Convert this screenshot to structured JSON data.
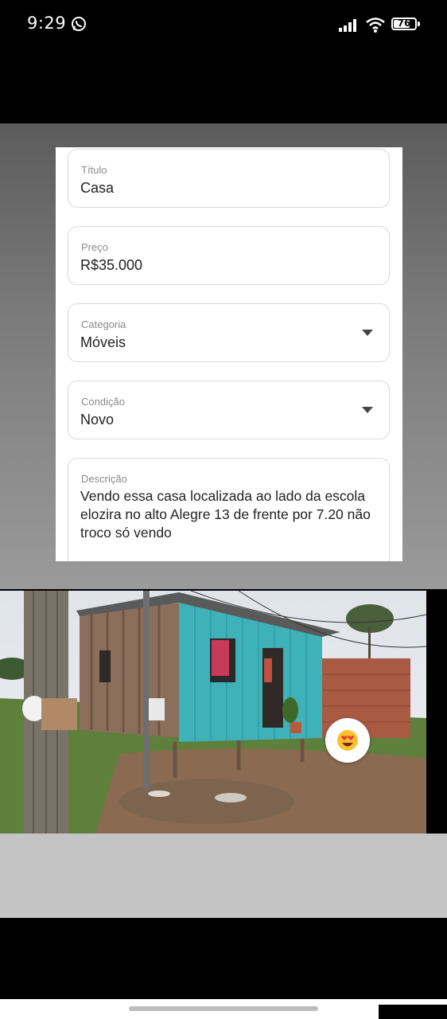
{
  "status_bar": {
    "time": "9:29",
    "battery": "76",
    "battery_level": 0.76
  },
  "form": {
    "fields": [
      {
        "label": "Título",
        "value": "Casa"
      },
      {
        "label": "Preço",
        "value": "R$35.000"
      },
      {
        "label": "Categoria",
        "value": "Móveis"
      },
      {
        "label": "Condição",
        "value": "Novo"
      },
      {
        "label": "Descrição",
        "value": "Vendo essa casa localizada ao lado da escola elozira no alto Alegre 13 de frente por 7.20 não troco só vendo"
      }
    ]
  },
  "reaction": {
    "emoji": "😍"
  }
}
